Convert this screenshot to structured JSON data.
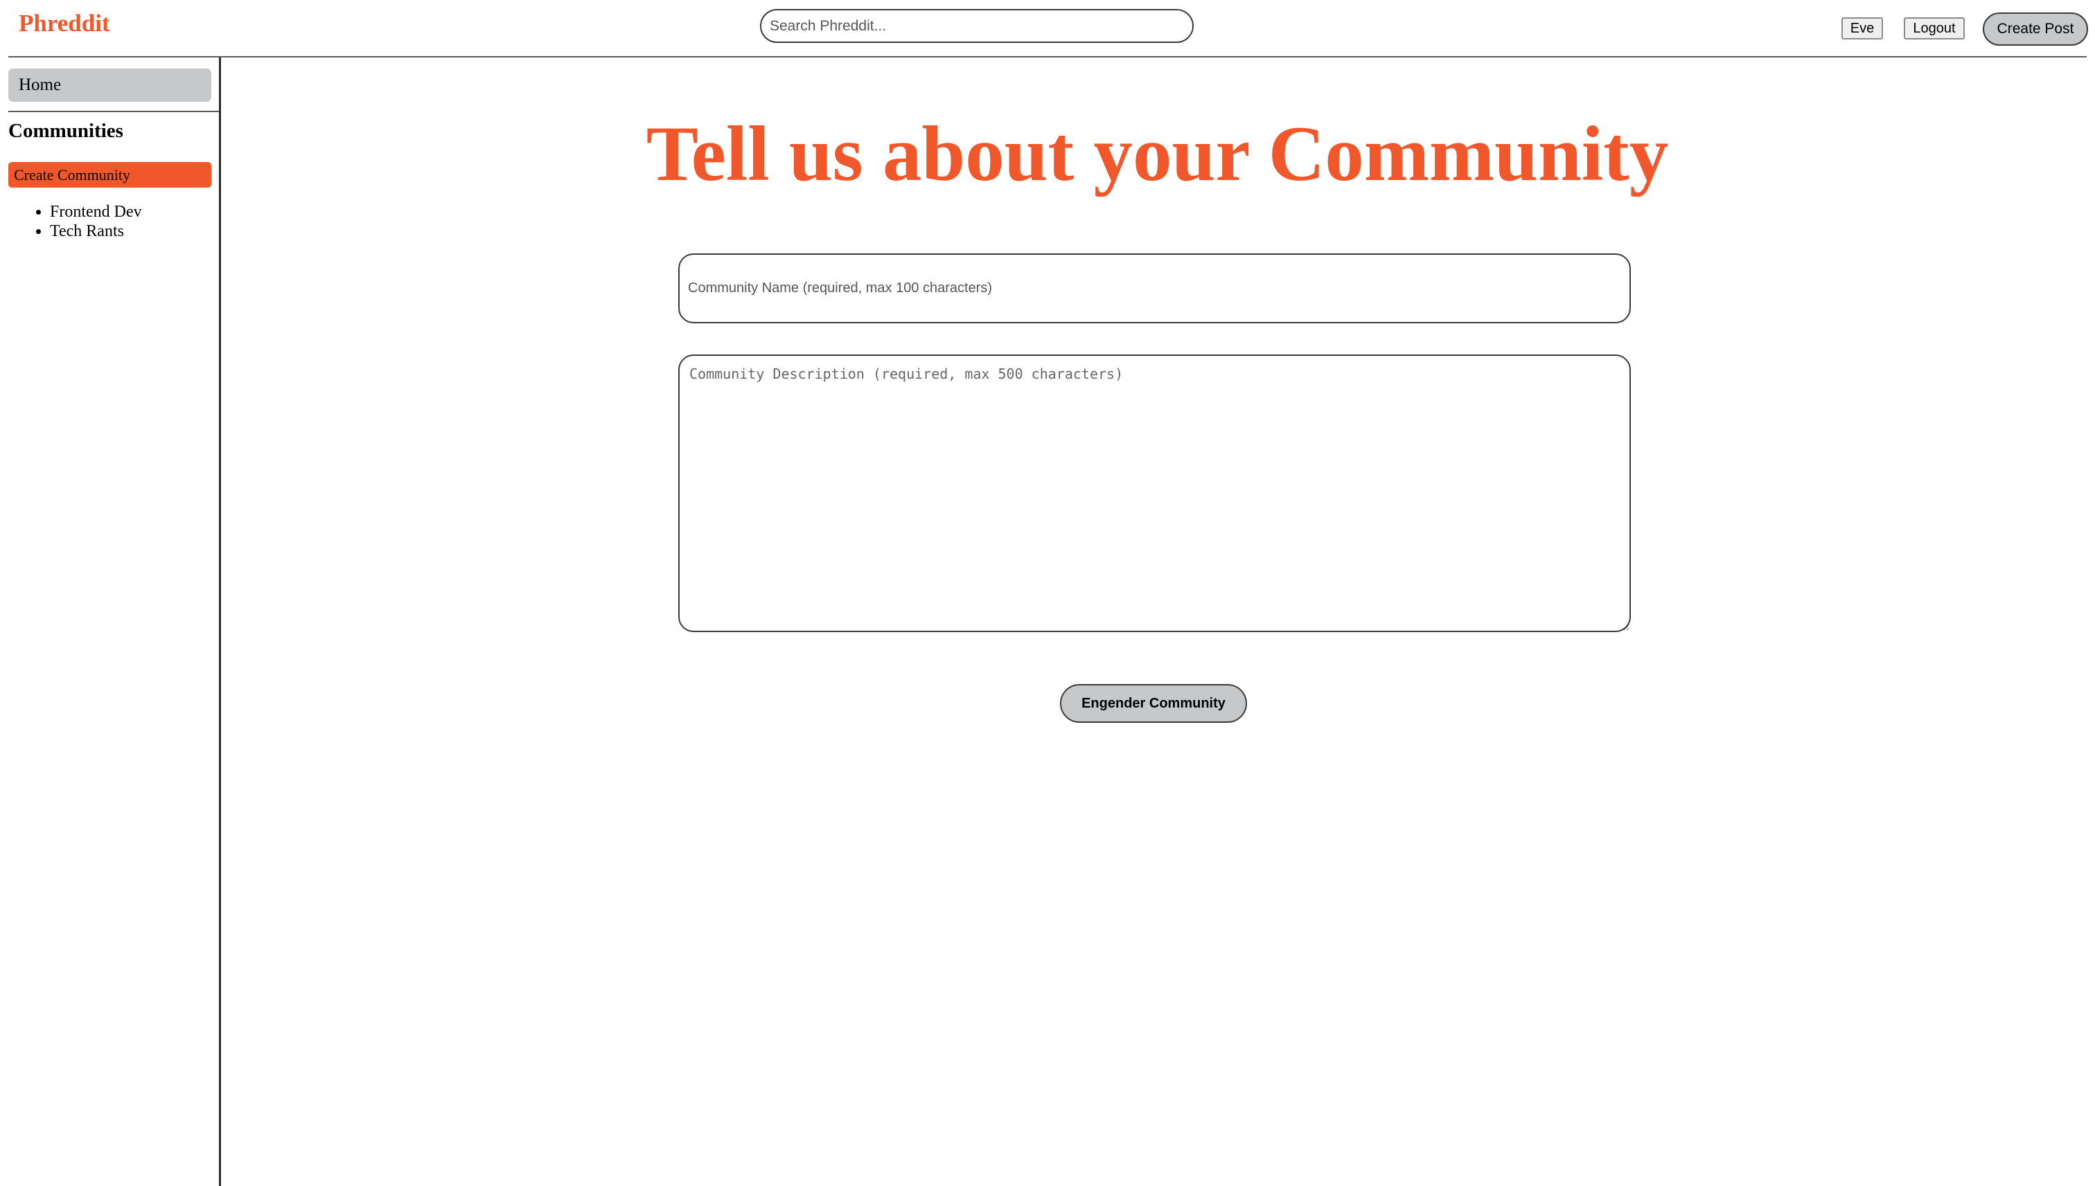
{
  "header": {
    "logo": "Phreddit",
    "search_placeholder": "Search Phreddit...",
    "user_label": "Eve",
    "logout_label": "Logout",
    "create_post_label": "Create Post"
  },
  "sidebar": {
    "home_label": "Home",
    "communities_heading": "Communities",
    "create_community_label": "Create Community",
    "communities": [
      "Frontend Dev",
      "Tech Rants"
    ]
  },
  "main": {
    "title": "Tell us about your Community",
    "name_placeholder": "Community Name (required, max 100 characters)",
    "description_placeholder": "Community Description (required, max 500 characters)",
    "submit_label": "Engender Community"
  },
  "colors": {
    "accent": "#f0572a",
    "button_gray": "#c6c8ca"
  }
}
